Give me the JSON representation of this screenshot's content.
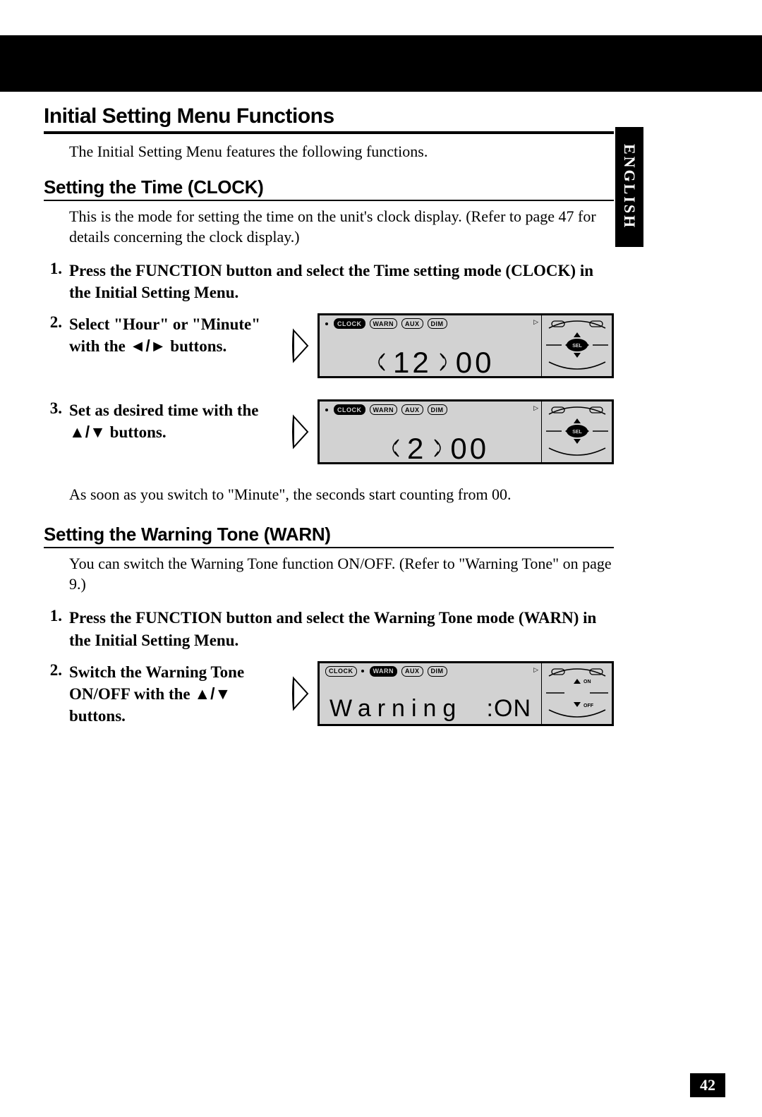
{
  "language_tab": "ENGLISH",
  "page_number": "42",
  "main_heading": "Initial Setting Menu Functions",
  "main_intro": "The Initial Setting Menu features the following functions.",
  "section_clock": {
    "heading": "Setting the Time (CLOCK)",
    "desc": "This is the mode for setting the time on the unit's clock display. (Refer to page 47 for details concerning the clock display.)",
    "steps": {
      "s1_num": "1.",
      "s1_text": "Press the FUNCTION button and select the Time setting mode (CLOCK) in the Initial Setting Menu.",
      "s2_num": "2.",
      "s2_text_a": "Select \"Hour\" or \"Minute\" with the ",
      "s2_text_b": " buttons.",
      "s3_num": "3.",
      "s3_text_a": "Set as desired time with the ",
      "s3_text_b": " buttons."
    },
    "note": "As soon as you switch to \"Minute\", the seconds start counting from 00."
  },
  "section_warn": {
    "heading": "Setting the Warning Tone (WARN)",
    "desc": "You can switch the Warning Tone function ON/OFF. (Refer to \"Warning Tone\" on page 9.)",
    "steps": {
      "s1_num": "1.",
      "s1_text": "Press the FUNCTION button and select the Warning Tone mode (WARN) in the Initial Setting Menu.",
      "s2_num": "2.",
      "s2_text_a": "Switch the Warning Tone ON/OFF with the ",
      "s2_text_b": " buttons."
    }
  },
  "lcd": {
    "tabs": {
      "clock": "CLOCK",
      "warn": "WARN",
      "aux": "AUX",
      "dim": "DIM"
    },
    "fig1": {
      "hour": "12",
      "min": "00"
    },
    "fig2": {
      "hour": "2",
      "min": "00"
    },
    "fig3": {
      "label": "Warning",
      "value": ":ON"
    },
    "side_sel": "SEL",
    "side_on": "ON",
    "side_off": "OFF"
  }
}
